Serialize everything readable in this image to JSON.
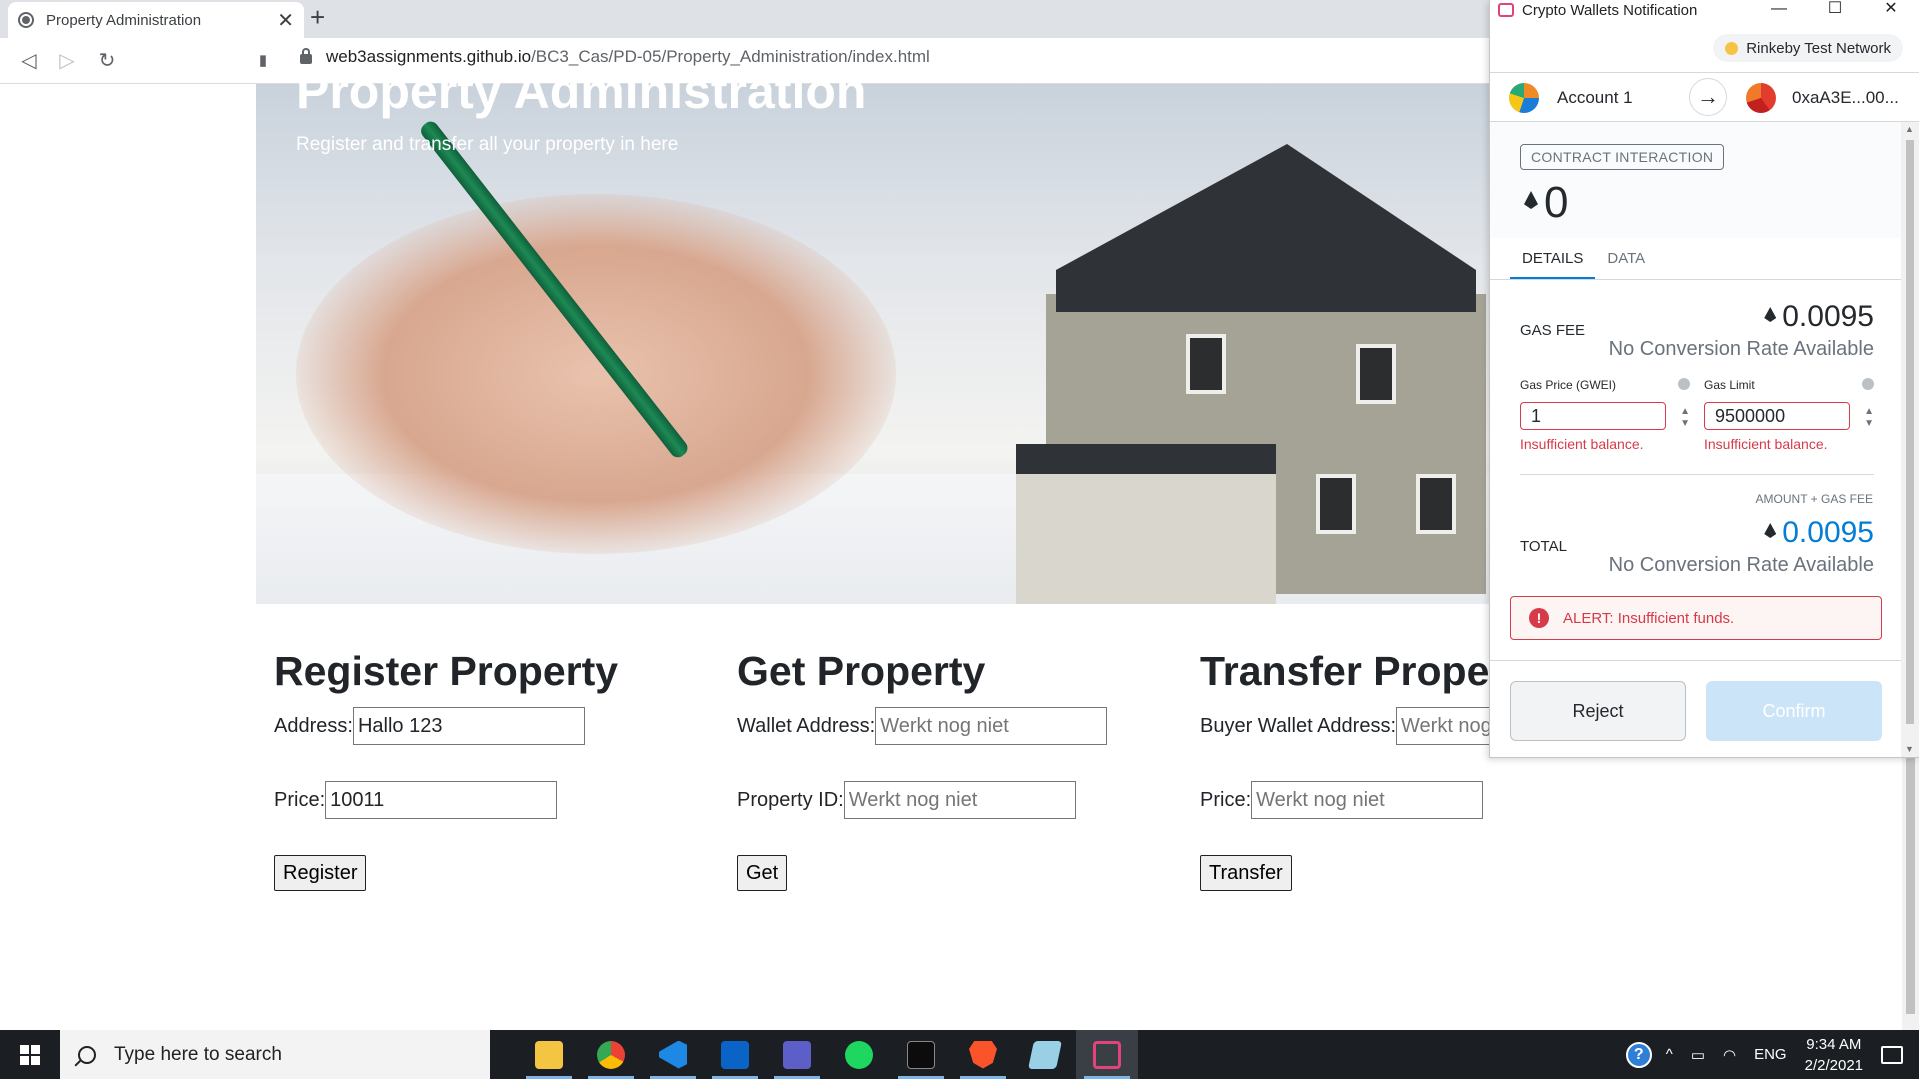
{
  "browser": {
    "tab_title": "Property Administration",
    "url_host": "web3assignments.github.io",
    "url_path": "/BC3_Cas/PD-05/Property_Administration/index.html",
    "close_glyph": "✕",
    "newtab_glyph": "+",
    "back_glyph": "◁",
    "forward_glyph": "▷",
    "reload_glyph": "↻",
    "bookmark_glyph": "🔖"
  },
  "hero": {
    "title": "Property Administration",
    "subtitle": "Register and transfer all your property in here"
  },
  "register": {
    "heading": "Register Property",
    "address_label": "Address:",
    "address_value": "Hallo 123",
    "price_label": "Price:",
    "price_value": "10011",
    "button": "Register"
  },
  "get": {
    "heading": "Get Property",
    "wallet_label": "Wallet Address:",
    "wallet_placeholder": "Werkt nog niet",
    "id_label": "Property ID:",
    "id_placeholder": "Werkt nog niet",
    "button": "Get"
  },
  "transfer": {
    "heading": "Transfer Property",
    "buyer_label": "Buyer Wallet Address:",
    "buyer_placeholder": "Werkt nog niet",
    "price_label": "Price:",
    "price_placeholder": "Werkt nog niet",
    "button": "Transfer"
  },
  "wallet": {
    "window_title": "Crypto Wallets Notification",
    "minimize": "—",
    "maximize": "☐",
    "close": "✕",
    "network": "Rinkeby Test Network",
    "from_account": "Account 1",
    "arrow": "→",
    "to_account": "0xaA3E...00...",
    "badge": "CONTRACT INTERACTION",
    "amount": "0",
    "tabs": [
      "DETAILS",
      "DATA"
    ],
    "gas_fee_label": "GAS FEE",
    "gas_fee_value": "0.0095",
    "gas_fee_sub": "No Conversion Rate Available",
    "gas_price_label": "Gas Price (GWEI)",
    "gas_price_value": "1",
    "gas_limit_label": "Gas Limit",
    "gas_limit_value": "9500000",
    "insufficient": "Insufficient balance.",
    "amount_gas_label": "AMOUNT + GAS FEE",
    "total_label": "TOTAL",
    "total_value": "0.0095",
    "total_sub": "No Conversion Rate Available",
    "alert": "ALERT: Insufficient funds.",
    "alert_icon": "!",
    "reject": "Reject",
    "confirm": "Confirm"
  },
  "taskbar": {
    "search_placeholder": "Type here to search",
    "apps": [
      "file-explorer",
      "chrome",
      "vscode",
      "outlook",
      "teams",
      "spotify",
      "terminal",
      "brave",
      "notepad",
      "crypto-wallet"
    ],
    "tray_caret": "^",
    "language": "ENG",
    "time": "9:34 AM",
    "date": "2/2/2021",
    "help_glyph": "?"
  },
  "colors": {
    "accent": "#037dd6",
    "error": "#d73a49",
    "network_dot": "#f6c343",
    "taskbar": "#1b1f24"
  }
}
